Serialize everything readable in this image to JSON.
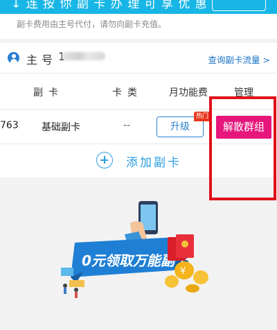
{
  "banner": {
    "clipped_text": "↓ 连 按 你 副 卡 办 理 可 享 优 惠"
  },
  "notice": {
    "text": "副卡费用由主号代付，请勿向副卡充值。"
  },
  "owner": {
    "label": "主号",
    "number_prefix": "1",
    "traffic_link": "查询副卡流量 >"
  },
  "table": {
    "headers": {
      "card": "副卡",
      "type": "卡类",
      "fee": "月功能费",
      "manage": "管理"
    },
    "rows": [
      {
        "number": "763",
        "type": "基础副卡",
        "fee": "--",
        "upgrade_label": "升级",
        "hot_badge": "热门",
        "disband_label": "解散群组"
      }
    ]
  },
  "add": {
    "label": "添加副卡"
  },
  "promo": {
    "title_text": "0元领取万能副卡"
  },
  "colors": {
    "brand_blue": "#18b6e6",
    "link_blue": "#1a73c7",
    "disband_pink": "#e6167b",
    "highlight_red": "#e01019"
  }
}
